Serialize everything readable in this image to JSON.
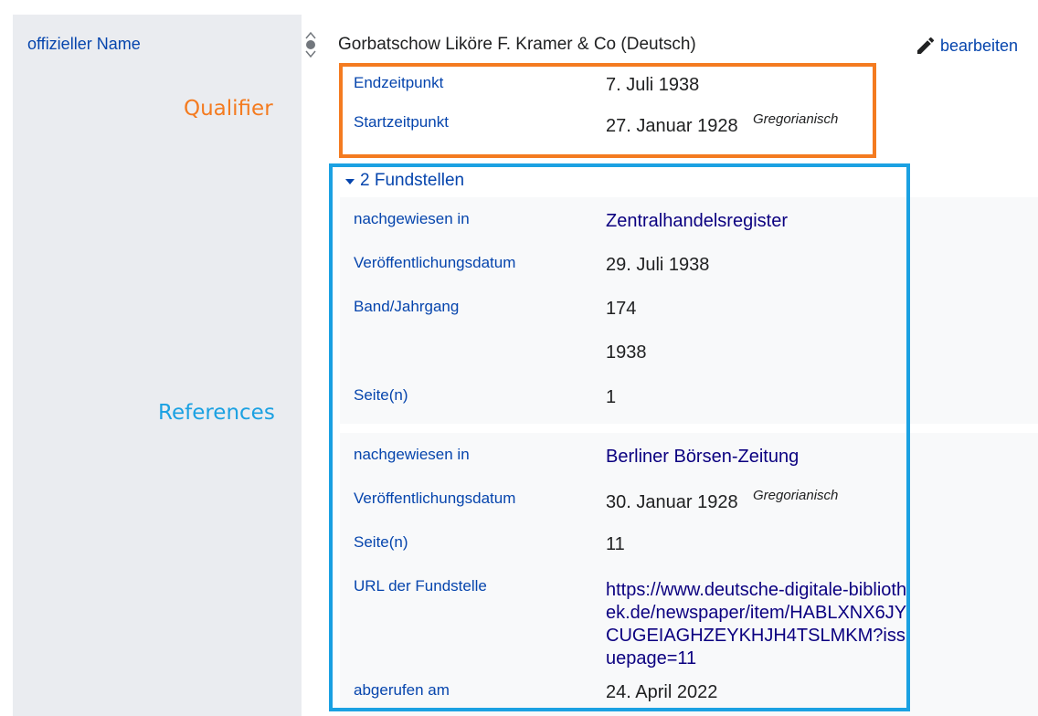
{
  "property": {
    "name": "offizieller Name"
  },
  "annotations": {
    "qualifier": "Qualifier",
    "references": "References"
  },
  "statement": {
    "value": "Gorbatschow Liköre F. Kramer & Co (Deutsch)",
    "edit_label": "bearbeiten"
  },
  "qualifiers": [
    {
      "property": "Endzeitpunkt",
      "value": "7. Juli 1938",
      "calendar": ""
    },
    {
      "property": "Startzeitpunkt",
      "value": "27. Januar 1928",
      "calendar": "Gregorianisch"
    }
  ],
  "references": {
    "toggle_label": "2 Fundstellen",
    "ref1": {
      "stated_in_label": "nachgewiesen in",
      "stated_in": "Zentralhandelsregister",
      "pubdate_label": "Veröffentlichungsdatum",
      "pubdate": "29. Juli 1938",
      "volume_label": "Band/Jahrgang",
      "volume_1": "174",
      "volume_2": "1938",
      "page_label": "Seite(n)",
      "page": "1"
    },
    "ref2": {
      "stated_in_label": "nachgewiesen in",
      "stated_in": "Berliner Börsen-Zeitung",
      "pubdate_label": "Veröffentlichungsdatum",
      "pubdate": "30. Januar 1928",
      "pubdate_calendar": "Gregorianisch",
      "page_label": "Seite(n)",
      "page": "11",
      "url_label": "URL der Fundstelle",
      "url": "https://www.deutsche-digitale-bibliothek.de/newspaper/item/HABLXNX6JYCUGEIAGHZEYKHJH4TSLMKM?issuepage=11",
      "retrieved_label": "abgerufen am",
      "retrieved": "24. April 2022"
    }
  },
  "colors": {
    "link": "#0645ad",
    "qualifier_highlight": "#f47b20",
    "reference_highlight": "#1ba1e2",
    "property_column_bg": "#eaecf0"
  },
  "icons": {
    "rank": "rank-selector-icon",
    "edit": "pencil-icon",
    "toggle": "triangle-down-icon"
  }
}
